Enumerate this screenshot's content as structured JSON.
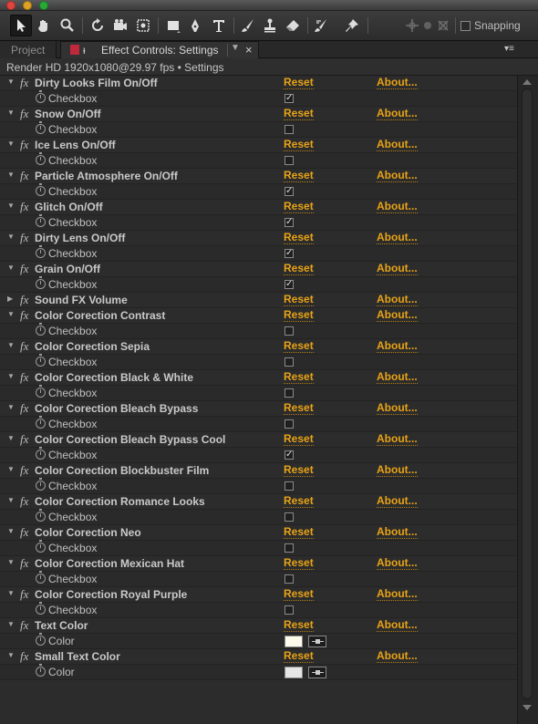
{
  "toolbar": {
    "snapping_label": "Snapping",
    "snapping_checked": false
  },
  "tabs": {
    "project_label": "Project",
    "effect_controls_label": "Effect Controls: Settings"
  },
  "panel": {
    "subtitle": "Render HD 1920x1080@29.97 fps • Settings"
  },
  "link_labels": {
    "reset": "Reset",
    "about": "About..."
  },
  "effects": [
    {
      "name": "Dirty Looks Film On/Off",
      "expanded": true,
      "property": {
        "label": "Checkbox",
        "type": "checkbox",
        "checked": true
      }
    },
    {
      "name": "Snow On/Off",
      "expanded": true,
      "property": {
        "label": "Checkbox",
        "type": "checkbox",
        "checked": false
      }
    },
    {
      "name": "Ice Lens On/Off",
      "expanded": true,
      "property": {
        "label": "Checkbox",
        "type": "checkbox",
        "checked": false
      }
    },
    {
      "name": "Particle Atmosphere On/Off",
      "expanded": true,
      "property": {
        "label": "Checkbox",
        "type": "checkbox",
        "checked": true
      }
    },
    {
      "name": "Glitch On/Off",
      "expanded": true,
      "property": {
        "label": "Checkbox",
        "type": "checkbox",
        "checked": true
      }
    },
    {
      "name": "Dirty Lens On/Off",
      "expanded": true,
      "property": {
        "label": "Checkbox",
        "type": "checkbox",
        "checked": true
      }
    },
    {
      "name": "Grain On/Off",
      "expanded": true,
      "property": {
        "label": "Checkbox",
        "type": "checkbox",
        "checked": true
      }
    },
    {
      "name": "Sound FX Volume",
      "expanded": false,
      "property": null
    },
    {
      "name": "Color Corection Contrast",
      "expanded": true,
      "property": {
        "label": "Checkbox",
        "type": "checkbox",
        "checked": false
      }
    },
    {
      "name": "Color Corection Sepia",
      "expanded": true,
      "property": {
        "label": "Checkbox",
        "type": "checkbox",
        "checked": false
      }
    },
    {
      "name": "Color Corection Black & White",
      "expanded": true,
      "property": {
        "label": "Checkbox",
        "type": "checkbox",
        "checked": false
      }
    },
    {
      "name": "Color Corection Bleach Bypass",
      "expanded": true,
      "property": {
        "label": "Checkbox",
        "type": "checkbox",
        "checked": false
      }
    },
    {
      "name": "Color Corection Bleach Bypass Cool",
      "expanded": true,
      "property": {
        "label": "Checkbox",
        "type": "checkbox",
        "checked": true
      }
    },
    {
      "name": "Color Corection Blockbuster Film",
      "expanded": true,
      "property": {
        "label": "Checkbox",
        "type": "checkbox",
        "checked": false
      }
    },
    {
      "name": "Color Corection Romance Looks",
      "expanded": true,
      "property": {
        "label": "Checkbox",
        "type": "checkbox",
        "checked": false
      }
    },
    {
      "name": "Color Corection Neo",
      "expanded": true,
      "property": {
        "label": "Checkbox",
        "type": "checkbox",
        "checked": false
      }
    },
    {
      "name": "Color Corection Mexican Hat",
      "expanded": true,
      "property": {
        "label": "Checkbox",
        "type": "checkbox",
        "checked": false
      }
    },
    {
      "name": "Color Corection Royal Purple",
      "expanded": true,
      "property": {
        "label": "Checkbox",
        "type": "checkbox",
        "checked": false
      }
    },
    {
      "name": "Text Color",
      "expanded": true,
      "property": {
        "label": "Color",
        "type": "color",
        "color": "#fdfbea"
      }
    },
    {
      "name": "Small Text Color",
      "expanded": true,
      "property": {
        "label": "Color",
        "type": "color",
        "color": "#e6e6e6"
      }
    }
  ],
  "colors": {
    "link": "#e8a316",
    "panel_bg": "#2c2c2c",
    "tab_color_label": "#c0283c"
  }
}
